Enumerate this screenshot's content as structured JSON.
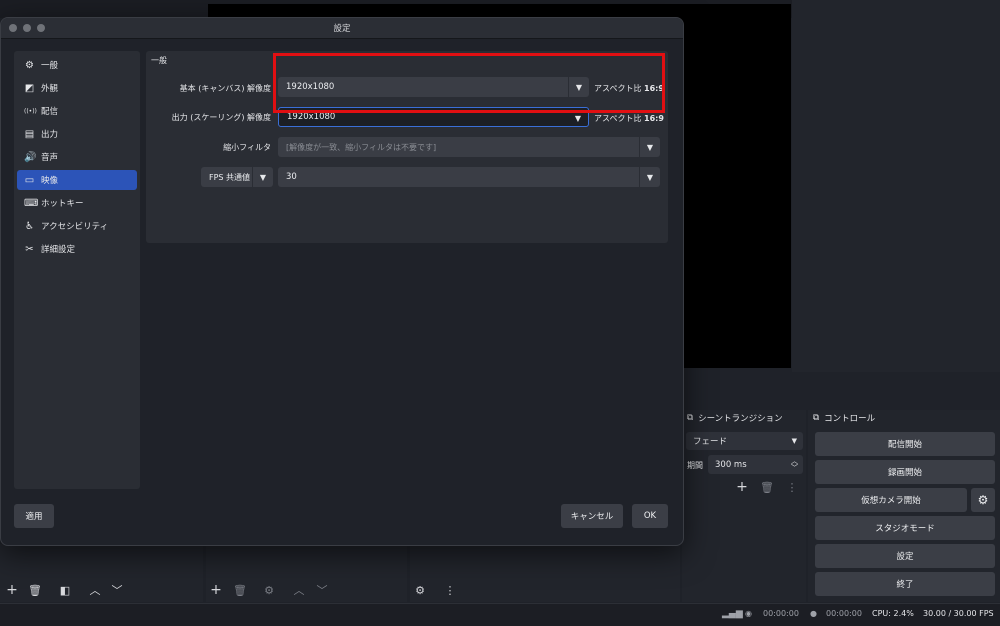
{
  "dialog": {
    "title": "設定",
    "sidebar": [
      {
        "label": "一般",
        "icon": "gear-icon",
        "glyph": "⚙",
        "active": false
      },
      {
        "label": "外観",
        "icon": "appearance-icon",
        "glyph": "◩",
        "active": false
      },
      {
        "label": "配信",
        "icon": "antenna-icon",
        "glyph": "((•))",
        "active": false
      },
      {
        "label": "出力",
        "icon": "output-icon",
        "glyph": "▤",
        "active": false
      },
      {
        "label": "音声",
        "icon": "speaker-icon",
        "glyph": "🔊",
        "active": false
      },
      {
        "label": "映像",
        "icon": "monitor-icon",
        "glyph": "▭",
        "active": true
      },
      {
        "label": "ホットキー",
        "icon": "keyboard-icon",
        "glyph": "⌨",
        "active": false
      },
      {
        "label": "アクセシビリティ",
        "icon": "accessibility-icon",
        "glyph": "♿",
        "active": false
      },
      {
        "label": "詳細設定",
        "icon": "tools-icon",
        "glyph": "✂",
        "active": false
      }
    ],
    "group_title": "一般",
    "base_resolution": {
      "label": "基本 (キャンバス) 解像度",
      "value": "1920x1080",
      "aspect_label": "アスペクト比",
      "aspect_value": "16:9"
    },
    "output_resolution": {
      "label": "出力 (スケーリング) 解像度",
      "value": "1920x1080",
      "aspect_label": "アスペクト比",
      "aspect_value": "16:9"
    },
    "downscale_filter": {
      "label": "縮小フィルタ",
      "value": "[解像度が一致、縮小フィルタは不要です]"
    },
    "fps": {
      "type_value": "FPS 共通値",
      "value": "30"
    },
    "apply_label": "適用",
    "cancel_label": "キャンセル",
    "ok_label": "OK"
  },
  "transitions": {
    "title": "シーントランジション",
    "type_value": "フェード",
    "duration_label": "期間",
    "duration_value": "300 ms"
  },
  "controls": {
    "title": "コントロール",
    "start_streaming": "配信開始",
    "start_recording": "録画開始",
    "start_virtual_camera": "仮想カメラ開始",
    "studio_mode": "スタジオモード",
    "settings": "設定",
    "exit": "終了"
  },
  "status": {
    "stream_time": "00:00:00",
    "record_time": "00:00:00",
    "cpu": "CPU: 2.4%",
    "fps": "30.00 / 30.00 FPS"
  },
  "colors": {
    "accent": "#2c54b8",
    "highlight": "#e10f12"
  }
}
